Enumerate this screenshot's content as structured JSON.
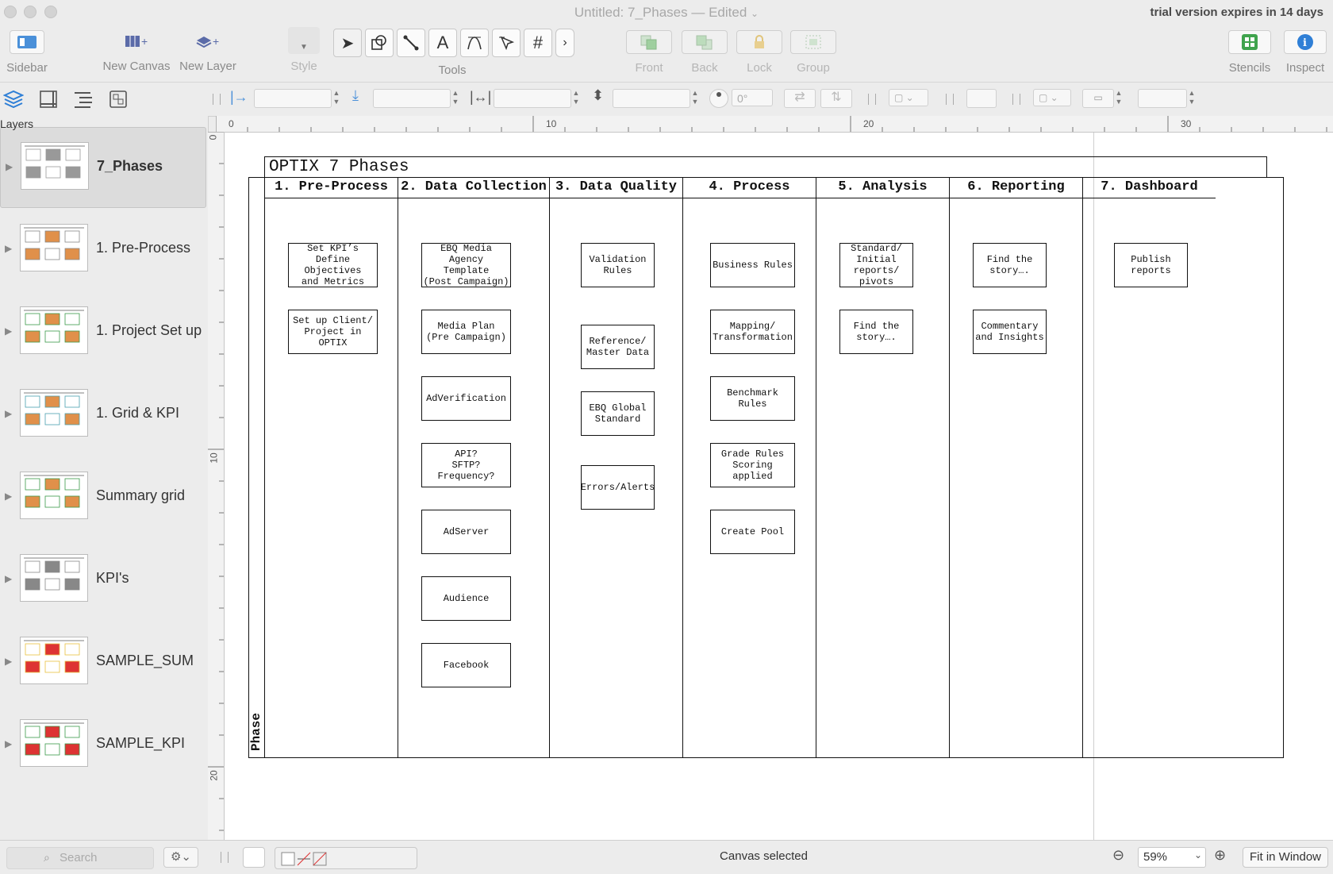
{
  "window": {
    "title": "Untitled: 7_Phases",
    "edited": "— Edited",
    "trial": "trial version expires in 14 days"
  },
  "toolbar": {
    "sidebar": "Sidebar",
    "new_canvas": "New Canvas",
    "new_layer": "New Layer",
    "style": "Style",
    "tools": "Tools",
    "front": "Front",
    "back": "Back",
    "lock": "Lock",
    "group": "Group",
    "stencils": "Stencils",
    "inspect": "Inspect"
  },
  "geometry_bar": {
    "rotation": "0°"
  },
  "sidebar": {
    "label": "Layers",
    "canvases": [
      {
        "name": "7_Phases",
        "active": true
      },
      {
        "name": "1. Pre-Process"
      },
      {
        "name": "1. Project Set up"
      },
      {
        "name": "1. Grid & KPI"
      },
      {
        "name": "Summary grid"
      },
      {
        "name": "KPI's"
      },
      {
        "name": "SAMPLE_SUM"
      },
      {
        "name": "SAMPLE_KPI"
      }
    ]
  },
  "rulers": {
    "h": [
      "0",
      "10",
      "20",
      "30"
    ],
    "v": [
      "0",
      "10",
      "20"
    ]
  },
  "diagram": {
    "title": "OPTIX 7 Phases",
    "phase_label": "Phase",
    "columns": [
      {
        "header": "1. Pre-Process",
        "boxes": [
          "Set KPI’s\nDefine Objectives\nand Metrics",
          "Set up Client/\nProject in OPTIX"
        ]
      },
      {
        "header": "2. Data Collection",
        "boxes": [
          "EBQ Media Agency\nTemplate\n(Post Campaign)",
          "Media Plan\n(Pre Campaign)",
          "AdVerification",
          "API?\nSFTP?\nFrequency?",
          "AdServer",
          "Audience",
          "Facebook"
        ]
      },
      {
        "header": "3. Data Quality",
        "boxes": [
          "Validation\nRules",
          "Reference/\nMaster Data",
          "EBQ Global\nStandard",
          "Errors/Alerts"
        ]
      },
      {
        "header": "4. Process",
        "boxes": [
          "Business Rules",
          "Mapping/\nTransformation",
          "Benchmark Rules",
          "Grade Rules\nScoring applied",
          "Create Pool"
        ]
      },
      {
        "header": "5. Analysis",
        "boxes": [
          "Standard/\nInitial\nreports/\npivots",
          "Find the\nstory…."
        ]
      },
      {
        "header": "6. Reporting",
        "boxes": [
          "Find the\nstory….",
          "Commentary\nand Insights"
        ]
      },
      {
        "header": "7. Dashboard",
        "boxes": [
          "Publish\nreports"
        ]
      }
    ]
  },
  "status": {
    "search_placeholder": "Search",
    "message": "Canvas selected",
    "zoom": "59%",
    "fit": "Fit in Window"
  }
}
